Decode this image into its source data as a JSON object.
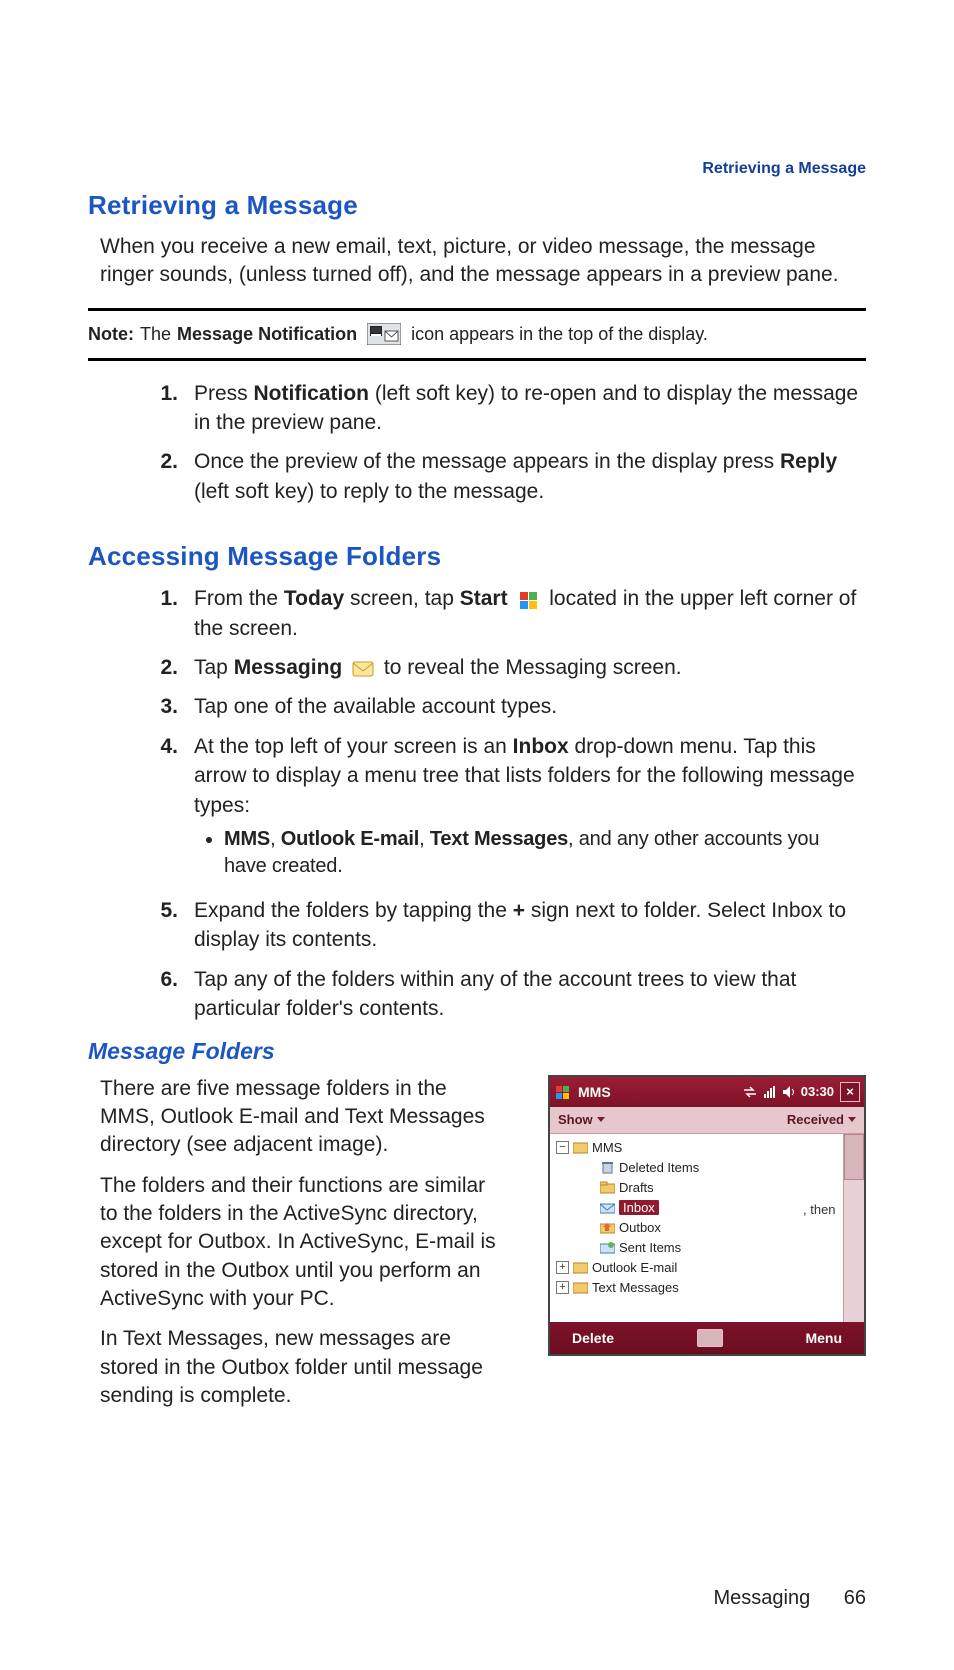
{
  "running_head": "Retrieving a Message",
  "section1": {
    "heading": "Retrieving a Message",
    "intro": "When you receive a new email, text, picture, or video message, the message ringer sounds, (unless turned off), and the message appears in a preview pane.",
    "note_label": "Note:",
    "note_pre": "The",
    "note_strong": "Message Notification",
    "note_post": "icon appears in the top of the display.",
    "steps": [
      {
        "num": "1.",
        "pre": "Press ",
        "b1": "Notification",
        "post": " (left soft key) to re-open and to display the message in the preview pane."
      },
      {
        "num": "2.",
        "pre": "Once the preview of the message appears in the display press ",
        "b1": "Reply",
        "post": " (left soft key) to reply to the message."
      }
    ]
  },
  "section2": {
    "heading": "Accessing Message Folders",
    "steps": [
      {
        "num": "1.",
        "pre": "From the ",
        "b1": "Today",
        "mid1": " screen, tap ",
        "b2": "Start",
        "icon": "start",
        "post": " located in the upper left corner of the screen."
      },
      {
        "num": "2.",
        "pre": "Tap ",
        "b1": "Messaging",
        "icon": "envelope",
        "post": " to reveal the Messaging screen."
      },
      {
        "num": "3.",
        "pre": "Tap one of the available account types."
      },
      {
        "num": "4.",
        "pre": "At the top left of your screen is an ",
        "b1": "Inbox",
        "post": " drop-down menu. Tap this arrow to display a menu tree that lists folders for the following message types:",
        "bullet": {
          "b1": "MMS",
          "sep1": ", ",
          "b2": "Outlook E-mail",
          "sep2": ", ",
          "b3": "Text Messages",
          "tail": ", and any other accounts you have created."
        }
      },
      {
        "num": "5.",
        "pre": "Expand the folders by tapping the ",
        "b1": "+",
        "post": " sign next to folder. Select Inbox to display its contents."
      },
      {
        "num": "6.",
        "pre": "Tap any of the folders within any of the account trees to view that particular folder's contents."
      }
    ]
  },
  "section3": {
    "heading": "Message Folders",
    "para1": "There are five message folders in the MMS, Outlook E-mail and Text Messages directory (see adjacent image).",
    "para2": "The folders and their functions are similar to the folders in the ActiveSync directory, except for Outbox. In ActiveSync, E-mail is stored in the Outbox until you perform an ActiveSync with your PC.",
    "para3": "In Text Messages, new messages are stored in the Outbox folder until message sending is complete."
  },
  "screenshot": {
    "title": "MMS",
    "clock": "03:30",
    "toolbar_left": "Show",
    "toolbar_right": "Received",
    "scroll_note": ", then",
    "tree": {
      "root_exp": "−",
      "mms": "MMS",
      "deleted": "Deleted Items",
      "drafts": "Drafts",
      "inbox": "Inbox",
      "outbox": "Outbox",
      "sent": "Sent Items",
      "outlook_exp": "+",
      "outlook": "Outlook E-mail",
      "text_exp": "+",
      "text": "Text Messages"
    },
    "footer_left": "Delete",
    "footer_right": "Menu"
  },
  "footer": {
    "section": "Messaging",
    "page": "66"
  },
  "icons": {
    "notification": "message-notification-icon",
    "start": "windows-start-icon",
    "envelope": "envelope-icon",
    "close": "×"
  }
}
